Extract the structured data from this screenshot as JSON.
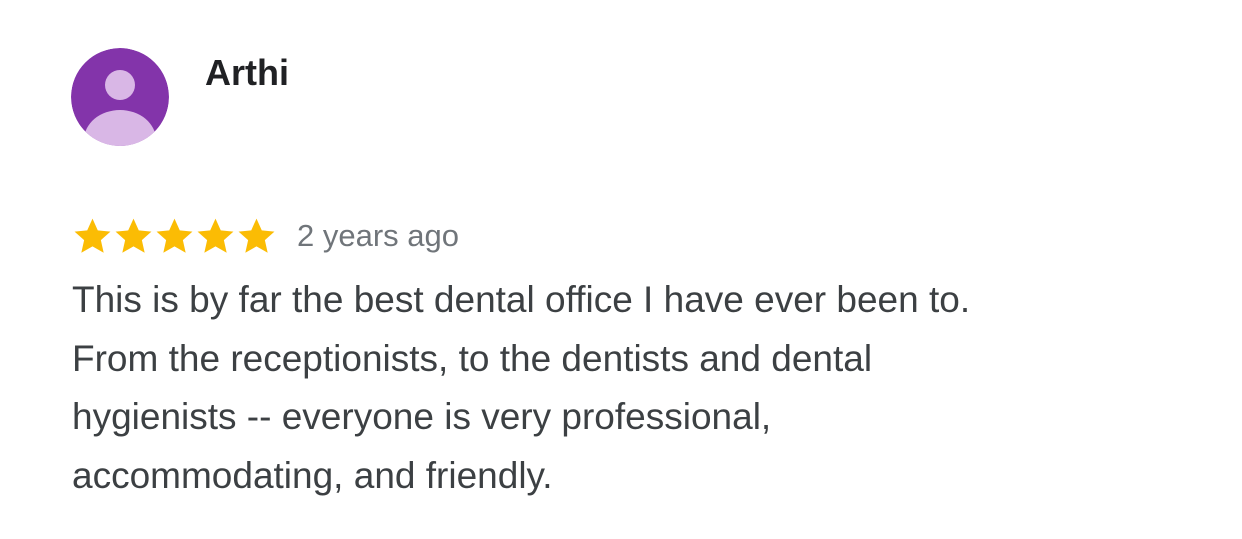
{
  "review": {
    "reviewer_name": "Arthi",
    "avatar_icon": "default-person-icon",
    "avatar_colors": {
      "background": "#8334aa",
      "figure": "#d9b7e6"
    },
    "rating": 5,
    "rating_max": 5,
    "star_icon": "star-icon",
    "star_color": "#fbbc04",
    "timestamp": "2 years ago",
    "text_lines": [
      "This is by far the best dental office I have ever been to.",
      "From the receptionists, to the dentists and dental",
      "hygienists -- everyone is very professional,",
      "accommodating, and friendly."
    ]
  }
}
